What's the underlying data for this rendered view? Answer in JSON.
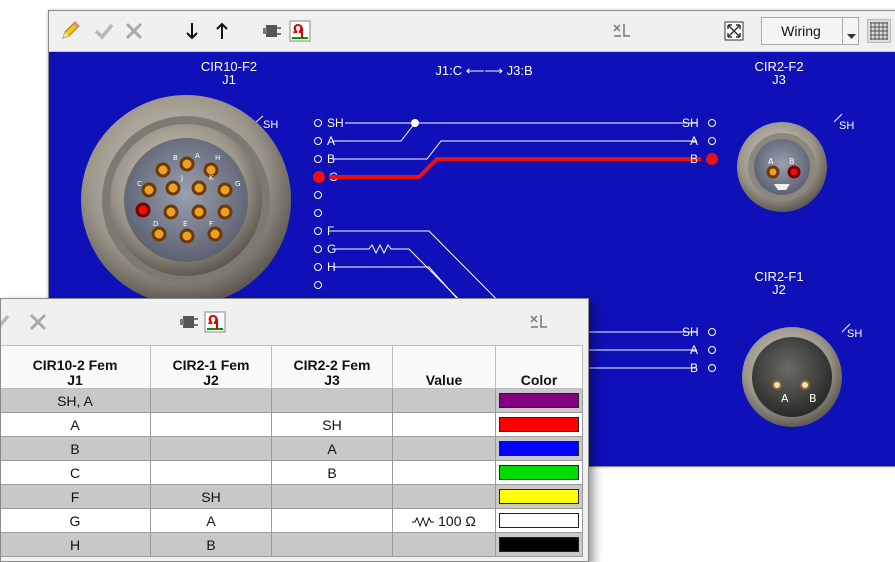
{
  "main_window": {
    "toolbar": {
      "view_select": "Wiring"
    },
    "connection_label": "J1:C ⟵⟶ J3:B",
    "connectors": [
      {
        "id": "J1",
        "title": "CIR10-F2",
        "ref": "J1",
        "shield": "SH",
        "pin_labels": [
          "SH",
          "A",
          "B",
          "C",
          "",
          "",
          "F",
          "G",
          "H",
          "",
          ""
        ],
        "face_letters": [
          "B",
          "A",
          "H",
          "C",
          "J",
          "K",
          "G",
          "D",
          "E",
          "F"
        ]
      },
      {
        "id": "J3",
        "title": "CIR2-F2",
        "ref": "J3",
        "shield": "SH",
        "pin_labels": [
          "SH",
          "A",
          "B"
        ],
        "face_letters": [
          "A",
          "B"
        ]
      },
      {
        "id": "J2",
        "title": "CIR2-F1",
        "ref": "J2",
        "shield": "SH",
        "pin_labels": [
          "SH",
          "A",
          "B"
        ],
        "face_letters": [
          "A",
          "B"
        ]
      }
    ],
    "highlight_color": "#e81010",
    "background_color": "#0f10b8"
  },
  "table_window": {
    "columns": [
      {
        "line1": "CIR10-2 Fem",
        "line2": "J1"
      },
      {
        "line1": "CIR2-1 Fem",
        "line2": "J2"
      },
      {
        "line1": "CIR2-2 Fem",
        "line2": "J3"
      },
      {
        "line1": "",
        "line2": "Value"
      },
      {
        "line1": "",
        "line2": "Color"
      }
    ],
    "rows": [
      {
        "j1": "SH, A",
        "j2": "",
        "j3": "",
        "value": "",
        "color": "#800080"
      },
      {
        "j1": "A",
        "j2": "",
        "j3": "SH",
        "value": "",
        "color": "#ff0000"
      },
      {
        "j1": "B",
        "j2": "",
        "j3": "A",
        "value": "",
        "color": "#0000ff"
      },
      {
        "j1": "C",
        "j2": "",
        "j3": "B",
        "value": "",
        "color": "#00dd00"
      },
      {
        "j1": "F",
        "j2": "SH",
        "j3": "",
        "value": "",
        "color": "#ffff00"
      },
      {
        "j1": "G",
        "j2": "A",
        "j3": "",
        "value": "100 Ω",
        "color": "#ffffff"
      },
      {
        "j1": "H",
        "j2": "B",
        "j3": "",
        "value": "",
        "color": "#000000"
      }
    ]
  }
}
